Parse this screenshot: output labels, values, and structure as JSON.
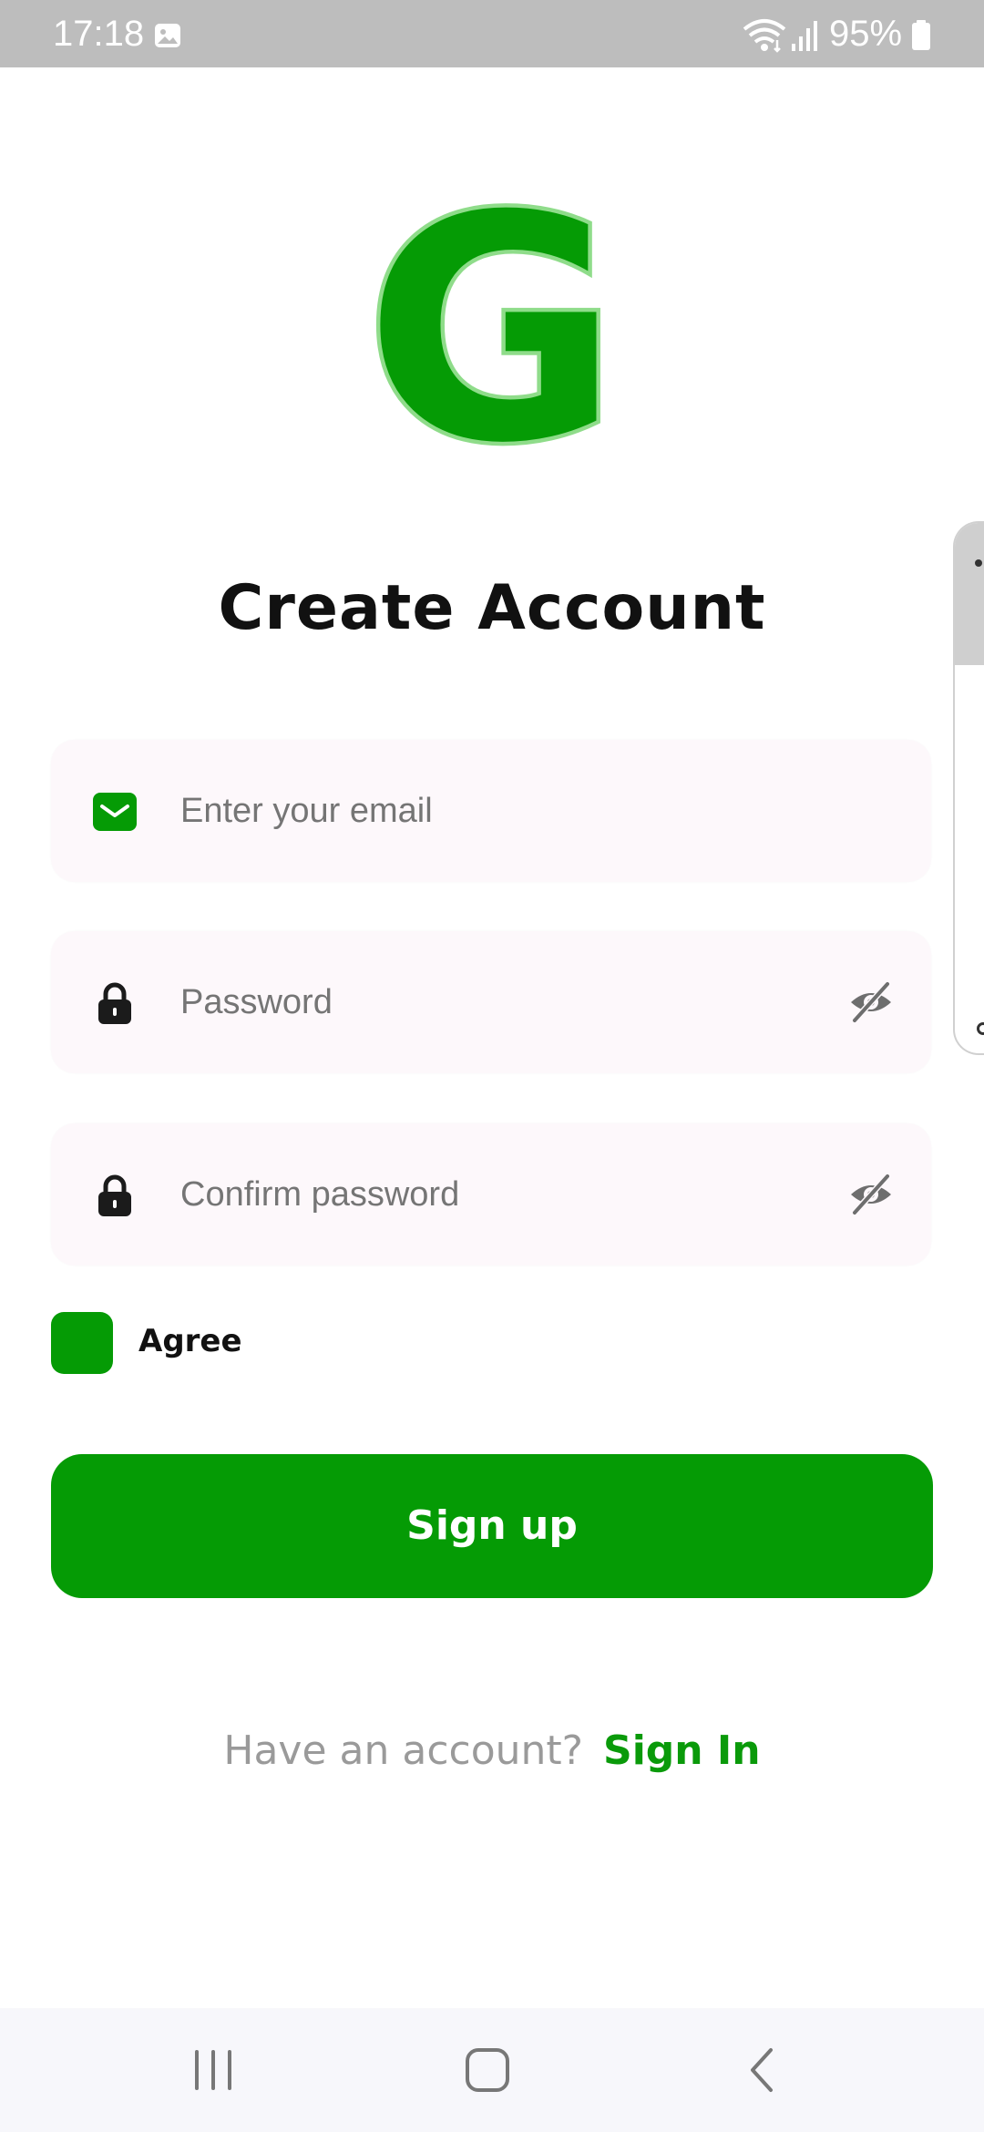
{
  "status_bar": {
    "time": "17:18",
    "battery": "95%",
    "icons": [
      "gallery-icon",
      "wifi-icon",
      "signal-icon",
      "battery-icon"
    ]
  },
  "logo": {
    "letter": "G",
    "color": "#059b05",
    "outline": "#8fdc8a"
  },
  "page_title": "Create Account",
  "form": {
    "email": {
      "placeholder": "Enter your email",
      "icon": "email-icon"
    },
    "password": {
      "placeholder": "Password",
      "icon": "lock-icon",
      "toggle_icon": "eye-off-icon"
    },
    "confirm_password": {
      "placeholder": "Confirm password",
      "icon": "lock-icon",
      "toggle_icon": "eye-off-icon"
    },
    "agree_label": "Agree",
    "agree_checked": true
  },
  "signup_button": "Sign up",
  "footer": {
    "question": "Have an account?",
    "link": "Sign In"
  },
  "nav_bar": {
    "buttons": [
      "recents-icon",
      "home-icon",
      "back-icon"
    ]
  },
  "colors": {
    "accent": "#059b05",
    "field_bg": "#fdf8fb",
    "muted_text": "#9a9a9a"
  }
}
